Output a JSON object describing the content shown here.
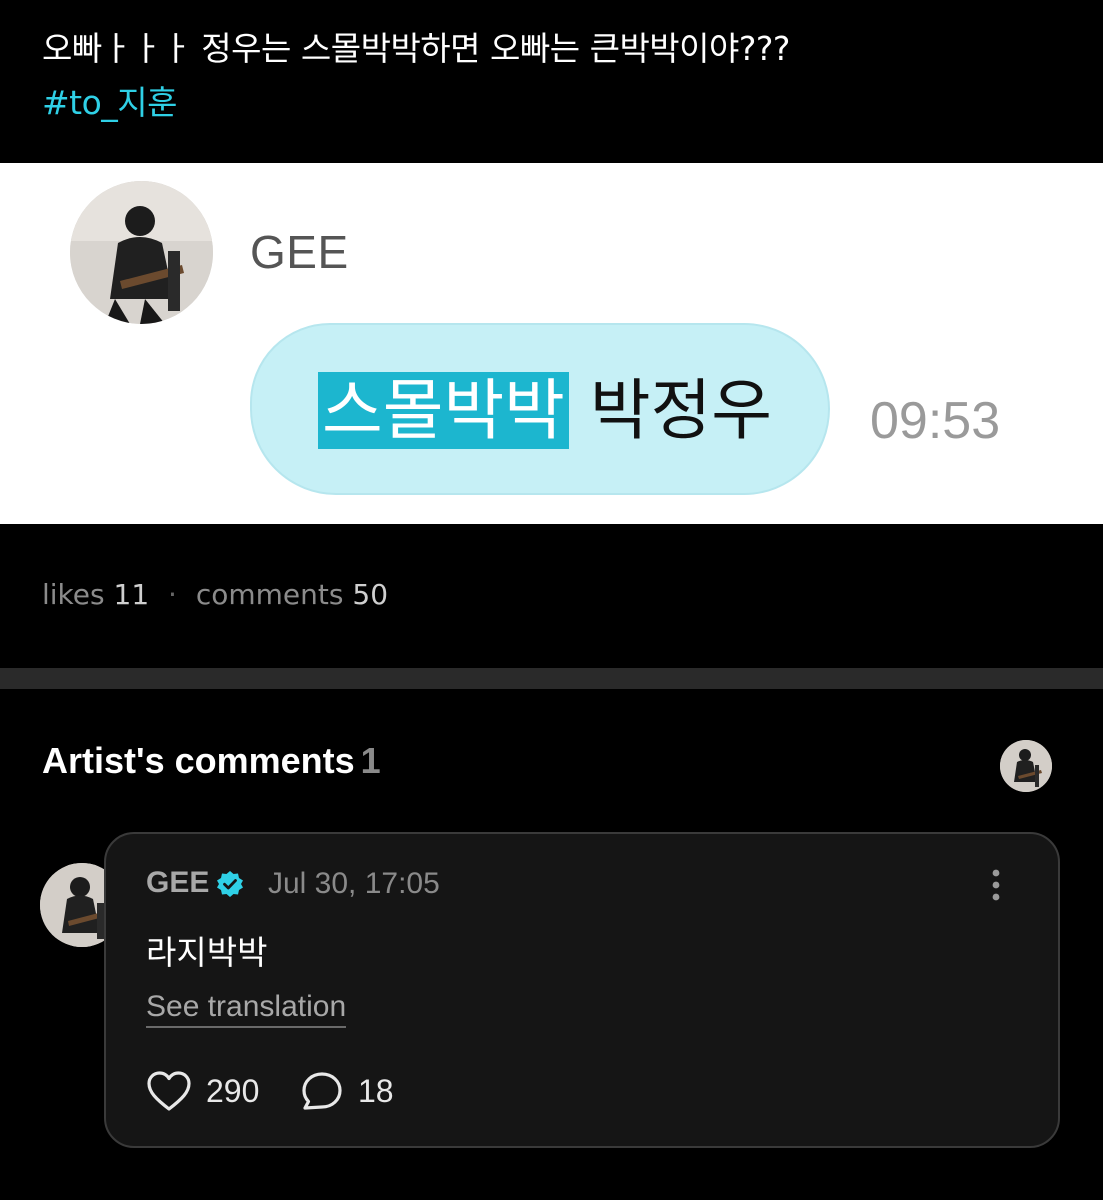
{
  "post": {
    "text": "오빠ㅏㅏㅏ 정우는 스몰박박하면 오빠는 큰박박이야???",
    "hashtag": "#to_지훈"
  },
  "chat_image": {
    "sender_name": "GEE",
    "message_highlight": "스몰박박",
    "message_rest": " 박정우",
    "time": "09:53",
    "colors": {
      "bubble": "#c6f0f6",
      "highlight": "#1cb6cf"
    }
  },
  "stats": {
    "likes_label": "likes",
    "likes_count": "11",
    "separator": "·",
    "comments_label": "comments",
    "comments_count": "50"
  },
  "artist_comments": {
    "title": "Artist's comments",
    "count": "1",
    "comment": {
      "author": "GEE",
      "verified_icon": "verified-check-icon",
      "date": "Jul 30, 17:05",
      "body": "라지박박",
      "see_translation": "See translation",
      "like_count": "290",
      "reply_count": "18"
    }
  },
  "colors": {
    "accent": "#2fd0e6",
    "background": "#000000",
    "card": "#151515"
  }
}
